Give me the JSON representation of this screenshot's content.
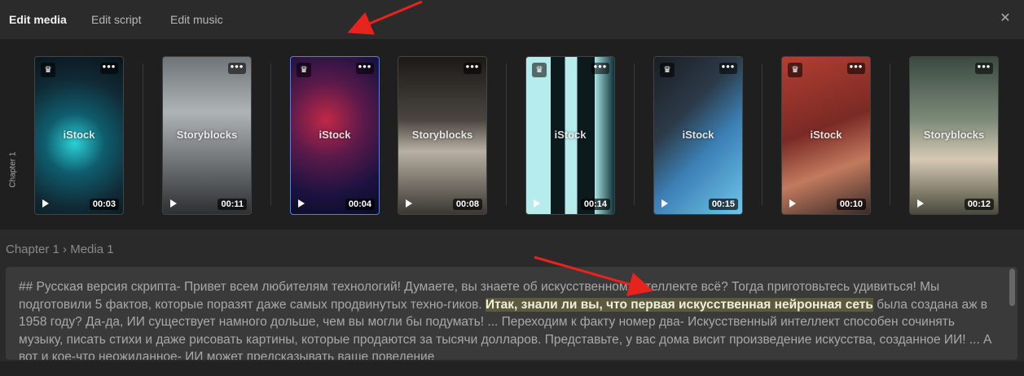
{
  "tabs": [
    "Edit media",
    "Edit script",
    "Edit music"
  ],
  "active_tab": "Edit media",
  "chapter_label": "Chapter 1",
  "media": [
    {
      "source": "iStock",
      "duration": "00:03",
      "premium": true,
      "selected": false
    },
    {
      "source": "Storyblocks",
      "duration": "00:11",
      "premium": false,
      "selected": false
    },
    {
      "source": "iStock",
      "duration": "00:04",
      "premium": true,
      "selected": true
    },
    {
      "source": "Storyblocks",
      "duration": "00:08",
      "premium": false,
      "selected": false
    },
    {
      "source": "iStock",
      "duration": "00:14",
      "premium": true,
      "selected": false
    },
    {
      "source": "iStock",
      "duration": "00:15",
      "premium": true,
      "selected": false
    },
    {
      "source": "iStock",
      "duration": "00:10",
      "premium": true,
      "selected": false
    },
    {
      "source": "Storyblocks",
      "duration": "00:12",
      "premium": false,
      "selected": false
    }
  ],
  "breadcrumb": {
    "chapter": "Chapter 1",
    "separator": "›",
    "media": "Media 1"
  },
  "script": {
    "text_before": "## Русская версия скрипта- Привет всем любителям технологий! Думаете, вы знаете об искусственном интеллекте всё? Тогда приготовьтесь удивиться! Мы подготовили 5 фактов, которые поразят даже самых продвинутых техно-гиков. ",
    "highlighted": "Итак, знали ли вы, что первая искусственная нейронная сеть",
    "text_after": " была создана аж в 1958 году? Да-да, ИИ существует намного дольше, чем вы могли бы подумать! ... Переходим к факту номер два- Искусственный интеллект способен сочинять музыку, писать стихи и даже рисовать картины, которые продаются за тысячи долларов. Представьте, у вас дома висит произведение искусства, созданное ИИ! ... А вот и кое-что неожиданное- ИИ может предсказывать ваше поведение"
  },
  "colors": {
    "accent": "#4a7fff",
    "highlight": "#5b5a3e",
    "annotation_arrow": "#e8231e"
  },
  "icons": {
    "close": "close-icon",
    "premium": "crown-icon",
    "more": "more-icon",
    "play": "play-icon"
  }
}
